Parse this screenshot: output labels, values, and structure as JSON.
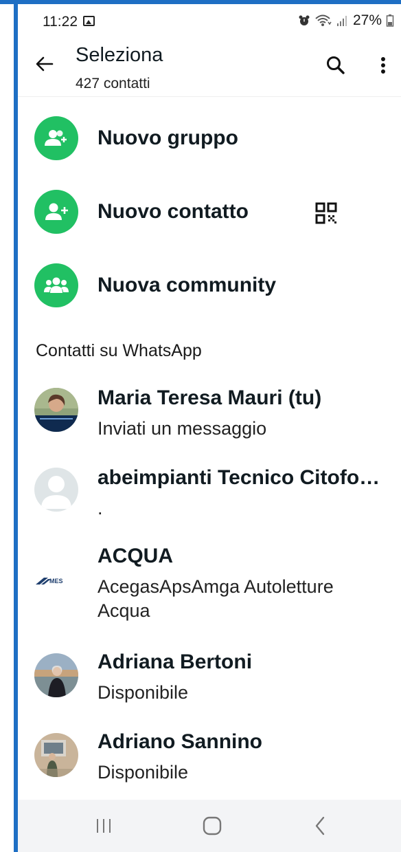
{
  "status_bar": {
    "time": "11:22",
    "battery": "27%"
  },
  "header": {
    "title": "Seleziona",
    "subtitle": "427 contatti"
  },
  "actions": [
    {
      "label": "Nuovo gruppo",
      "icon": "group-add-icon"
    },
    {
      "label": "Nuovo contatto",
      "icon": "person-add-icon"
    },
    {
      "label": "Nuova community",
      "icon": "community-icon"
    }
  ],
  "section_label": "Contatti su WhatsApp",
  "contacts": [
    {
      "name": "Maria Teresa Mauri (tu)",
      "status": "Inviati un messaggio"
    },
    {
      "name": "abeimpianti Tecnico Citofo…",
      "status": "."
    },
    {
      "name": "ACQUA",
      "status": "AcegasApsAmga Autoletture Acqua",
      "avatar_logo": "MES"
    },
    {
      "name": "Adriana Bertoni",
      "status": "Disponibile"
    },
    {
      "name": "Adriano Sannino",
      "status": "Disponibile"
    }
  ],
  "colors": {
    "accent": "#21c063",
    "frame": "#1e6fc4"
  }
}
